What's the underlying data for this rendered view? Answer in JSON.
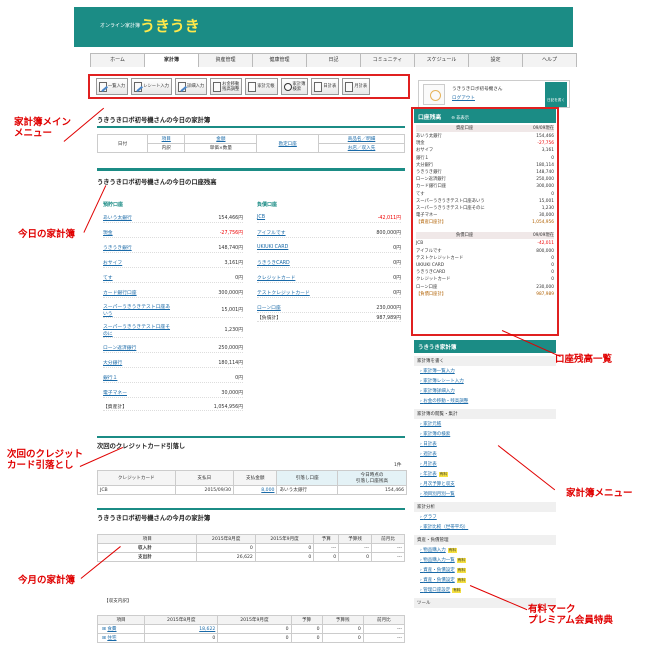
{
  "header": {
    "subtitle": "オンライン家計簿",
    "logo": "うきうき"
  },
  "nav": {
    "tabs": [
      "ホーム",
      "家計簿",
      "資産管理",
      "健康管理",
      "日記",
      "コミュニティ",
      "スケジュール",
      "設定",
      "ヘルプ"
    ],
    "active": "家計簿"
  },
  "toolbar": {
    "buttons": [
      {
        "label": "一覧入力",
        "icon": "pen-icon"
      },
      {
        "label": "レシート入力",
        "icon": "pen-icon"
      },
      {
        "label": "詳細入力",
        "icon": "pen-icon"
      },
      {
        "label": "お金移動\n残高調整",
        "icon": "money-icon"
      },
      {
        "label": "家計元帳",
        "icon": "ledger-icon"
      },
      {
        "label": "家計簿\n検索",
        "icon": "search-icon"
      },
      {
        "label": "日計表",
        "icon": "sheet-icon"
      },
      {
        "label": "月計表",
        "icon": "sheet-icon"
      }
    ]
  },
  "user": {
    "name": "うきうきロボ初号機さん",
    "logout": "ログアウト",
    "diary_btn": "日記を書く"
  },
  "today_book": {
    "title": "うきうきロボ初号機さんの今日の家計簿",
    "col_date": "日付",
    "col_item": "項目",
    "col_sub": "内訳",
    "col_amount": "金額",
    "col_unit": "単価×数量",
    "col_account": "口座",
    "col_deposit": "勘定口座",
    "col_store": "商品名／明細",
    "col_store2": "お店／収入先"
  },
  "today_balance": {
    "title": "うきうきロボ初号機さんの今日の口座残高",
    "deposit_header": "預貯口座",
    "deposit_rows": [
      {
        "name": "あいう太銀行",
        "value": "154,466円"
      },
      {
        "name": "現金",
        "value": "-27,756円",
        "neg": true
      },
      {
        "name": "うきうき銀行",
        "value": "148,740円"
      },
      {
        "name": "おサイフ",
        "value": "3,161円"
      },
      {
        "name": "てす",
        "value": "0円"
      },
      {
        "name": "カード銀行口座",
        "value": "300,000円"
      },
      {
        "name": "スーパーうきうきテスト口座あいう",
        "value": "15,001円"
      },
      {
        "name": "スーパーうきうきテスト口座そのに",
        "value": "1,230円"
      },
      {
        "name": "ローン返済銀行",
        "value": "250,000円"
      },
      {
        "name": "大分銀行",
        "value": "180,114円"
      },
      {
        "name": "銀行１",
        "value": "0円"
      },
      {
        "name": "電子マネー",
        "value": "30,000円"
      }
    ],
    "deposit_total_label": "【資産計】",
    "deposit_total": "1,054,956円",
    "debt_header": "負債口座",
    "debt_rows": [
      {
        "name": "JCB",
        "value": "-42,011円",
        "neg": true
      },
      {
        "name": "アイフルです",
        "value": "800,000円"
      },
      {
        "name": "UKIUKI CARD",
        "value": "0円"
      },
      {
        "name": "うきうきCARD",
        "value": "0円"
      },
      {
        "name": "クレジットカード",
        "value": "0円"
      },
      {
        "name": "テストクレジットカード",
        "value": "0円"
      },
      {
        "name": "ローン口座",
        "value": "230,000円"
      }
    ],
    "debt_total_label": "【負債計】",
    "debt_total": "987,989円"
  },
  "credit": {
    "title": "次回のクレジットカード引落し",
    "unit": "1件",
    "headers": [
      "クレジットカード",
      "支払日",
      "支払金額",
      "引落し口座",
      "今日時点の\n引落し口座残高"
    ],
    "row": [
      "JCB",
      "2015/09/30",
      "8,000",
      "あいう太銀行",
      "154,466"
    ]
  },
  "month_book": {
    "title": "うきうきロボ初号機さんの今月の家計簿",
    "headers": [
      "項目",
      "2015年8月度",
      "2015年9月度",
      "予算",
      "予算残",
      "前月比"
    ],
    "rows": [
      {
        "label": "収入計",
        "v": [
          "0",
          "0",
          "---",
          "---",
          "---"
        ]
      },
      {
        "label": "支出計",
        "v": [
          "26,622",
          "0",
          "0",
          "0",
          "---"
        ]
      }
    ],
    "breakdown_label": "【収支内訳】",
    "b_headers": [
      "項目",
      "2015年8月度",
      "2015年9月度",
      "予算",
      "予算残",
      "前月比"
    ],
    "b_rows": [
      {
        "label": "食費",
        "v": [
          "18,622",
          "0",
          "0",
          "0",
          "---"
        ]
      },
      {
        "label": "住宅",
        "v": [
          "0",
          "0",
          "0",
          "0",
          "---"
        ]
      }
    ]
  },
  "panel": {
    "title": "口座残高",
    "toggle": "非表示",
    "deposit_header": "資産口座",
    "deposit_date": "09/09現在",
    "deposit_rows": [
      [
        "あいう太銀行",
        "154,466"
      ],
      [
        "現金",
        "-27,756"
      ],
      [
        "おサイフ",
        "3,161"
      ],
      [
        "銀行１",
        "0"
      ],
      [
        "大分銀行",
        "180,114"
      ],
      [
        "うきうき銀行",
        "148,740"
      ],
      [
        "ローン返済銀行",
        "250,000"
      ],
      [
        "カード銀行口座",
        "300,000"
      ],
      [
        "てす",
        "0"
      ],
      [
        "スーパーうきうきテスト口座あいう",
        "15,001"
      ],
      [
        "スーパーうきうきテスト口座そのに",
        "1,230"
      ],
      [
        "電子マネー",
        "30,000"
      ]
    ],
    "deposit_total": [
      "【資産口座計】",
      "1,054,956"
    ],
    "debt_header": "負債口座",
    "debt_date": "09/09現在",
    "debt_rows": [
      [
        "JCB",
        "-42,011"
      ],
      [
        "アイフルです",
        "800,000"
      ],
      [
        "テストクレジットカード",
        "0"
      ],
      [
        "UKIUKI CARD",
        "0"
      ],
      [
        "うきうきCARD",
        "0"
      ],
      [
        "クレジットカード",
        "0"
      ],
      [
        "ローン口座",
        "230,000"
      ]
    ],
    "debt_total": [
      "【負債口座計】",
      "987,989"
    ]
  },
  "menu": {
    "title": "うきうき家計簿",
    "sections": [
      {
        "cat": "家計簿を書く",
        "items": [
          "家計簿一覧入力",
          "家計簿レシート入力",
          "家計簿詳細入力",
          "お金の移動・残高調整"
        ]
      },
      {
        "cat": "家計簿の閲覧・集計",
        "items": [
          "家計元帳",
          "家計簿の検索",
          "日計表",
          "週計表",
          "月計表",
          "年計表",
          "月次予算と収支",
          "項目別月別一覧"
        ]
      },
      {
        "cat": "家計分析",
        "items": [
          "グラフ",
          "家計比較（世帯平均）"
        ]
      },
      {
        "cat": "資産・負債管理",
        "items": [
          "物品購入力",
          "物品購入力一覧",
          "資産・負債設定",
          "資産・負債設定",
          "管理口座設定"
        ]
      },
      {
        "cat": "ツール",
        "items": []
      }
    ],
    "badge": "有料"
  },
  "annotations": {
    "a1": "家計簿メイン\nメニュー",
    "a2": "今日の家計簿",
    "a3": "次回のクレジット\nカード引落とし",
    "a4": "今月の家計簿",
    "a5": "口座残高一覧",
    "a6": "家計簿メニュー",
    "a7": "有料マーク\nプレミアム会員特典"
  }
}
